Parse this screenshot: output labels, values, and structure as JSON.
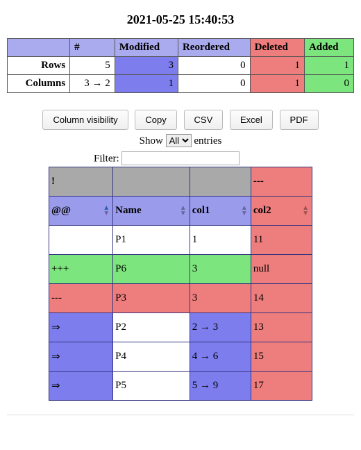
{
  "title": "2021-05-25 15:40:53",
  "summary": {
    "headers": {
      "blank": "",
      "count": "#",
      "modified": "Modified",
      "reordered": "Reordered",
      "deleted": "Deleted",
      "added": "Added"
    },
    "row_labels": {
      "rows": "Rows",
      "columns": "Columns"
    },
    "rows": {
      "count": "5",
      "modified": "3",
      "reordered": "0",
      "deleted": "1",
      "added": "1"
    },
    "columns": {
      "count": "3 → 2",
      "modified": "1",
      "reordered": "0",
      "deleted": "1",
      "added": "0"
    }
  },
  "toolbar": {
    "colvis": "Column visibility",
    "copy": "Copy",
    "csv": "CSV",
    "excel": "Excel",
    "pdf": "PDF"
  },
  "length": {
    "prefix": "Show",
    "selected": "All",
    "options": [
      "All"
    ],
    "suffix": "entries"
  },
  "filter": {
    "label": "Filter:",
    "value": ""
  },
  "diff": {
    "group_headers": [
      "!",
      "",
      "",
      "---"
    ],
    "columns": [
      {
        "label": "@@",
        "class": "",
        "sort": "asc"
      },
      {
        "label": "Name",
        "class": "",
        "sort": "both"
      },
      {
        "label": "col1",
        "class": "",
        "sort": "both"
      },
      {
        "label": "col2",
        "class": "col-del",
        "sort": "both"
      }
    ],
    "rows": [
      {
        "op": "",
        "cells": [
          {
            "v": "",
            "c": "c-white"
          },
          {
            "v": "P1",
            "c": "c-white"
          },
          {
            "v": "1",
            "c": "c-white"
          },
          {
            "v": "11",
            "c": "c-del"
          }
        ]
      },
      {
        "op": "+++",
        "cells": [
          {
            "v": "+++",
            "c": "c-add"
          },
          {
            "v": "P6",
            "c": "c-add"
          },
          {
            "v": "3",
            "c": "c-add"
          },
          {
            "v": "null",
            "c": "c-del"
          }
        ]
      },
      {
        "op": "---",
        "cells": [
          {
            "v": "---",
            "c": "c-del"
          },
          {
            "v": "P3",
            "c": "c-del"
          },
          {
            "v": "3",
            "c": "c-del"
          },
          {
            "v": "14",
            "c": "c-del"
          }
        ]
      },
      {
        "op": "⇒",
        "cells": [
          {
            "v": "⇒",
            "c": "c-mod"
          },
          {
            "v": "P2",
            "c": "c-white"
          },
          {
            "v": "2 → 3",
            "c": "c-mod"
          },
          {
            "v": "13",
            "c": "c-del"
          }
        ]
      },
      {
        "op": "⇒",
        "cells": [
          {
            "v": "⇒",
            "c": "c-mod"
          },
          {
            "v": "P4",
            "c": "c-white"
          },
          {
            "v": "4 → 6",
            "c": "c-mod"
          },
          {
            "v": "15",
            "c": "c-del"
          }
        ]
      },
      {
        "op": "⇒",
        "cells": [
          {
            "v": "⇒",
            "c": "c-mod"
          },
          {
            "v": "P5",
            "c": "c-white"
          },
          {
            "v": "5 → 9",
            "c": "c-mod"
          },
          {
            "v": "17",
            "c": "c-del"
          }
        ]
      }
    ]
  }
}
